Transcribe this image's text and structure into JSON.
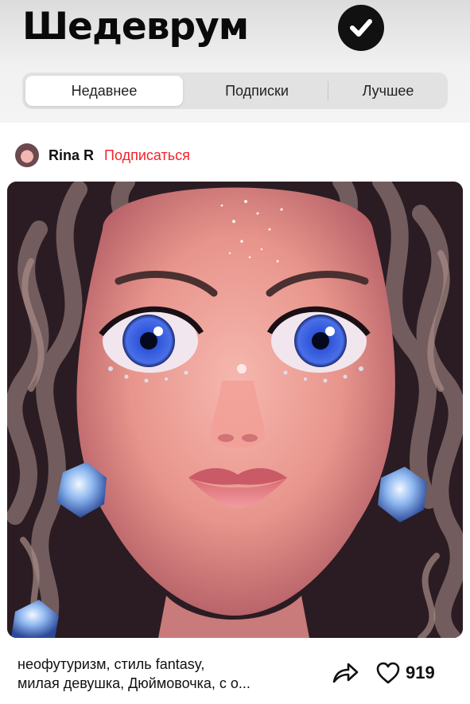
{
  "header": {
    "title": "Шедеврум",
    "badge_icon": "checkmark-icon"
  },
  "tabs": [
    {
      "label": "Недавнее",
      "active": true
    },
    {
      "label": "Подписки",
      "active": false
    },
    {
      "label": "Лучшее",
      "active": false
    }
  ],
  "post": {
    "author": "Rina R",
    "subscribe_label": "Подписаться",
    "caption_line1": "неофутуризм, стиль fantasy,",
    "caption_line2": "милая девушка, Дюймовочка, с о...",
    "share_icon": "share-arrow-icon",
    "like_icon": "heart-icon",
    "likes": "919"
  },
  "colors": {
    "accent_red": "#f5222d",
    "text_dark": "#111111",
    "tab_bg": "#e2e2e2"
  }
}
